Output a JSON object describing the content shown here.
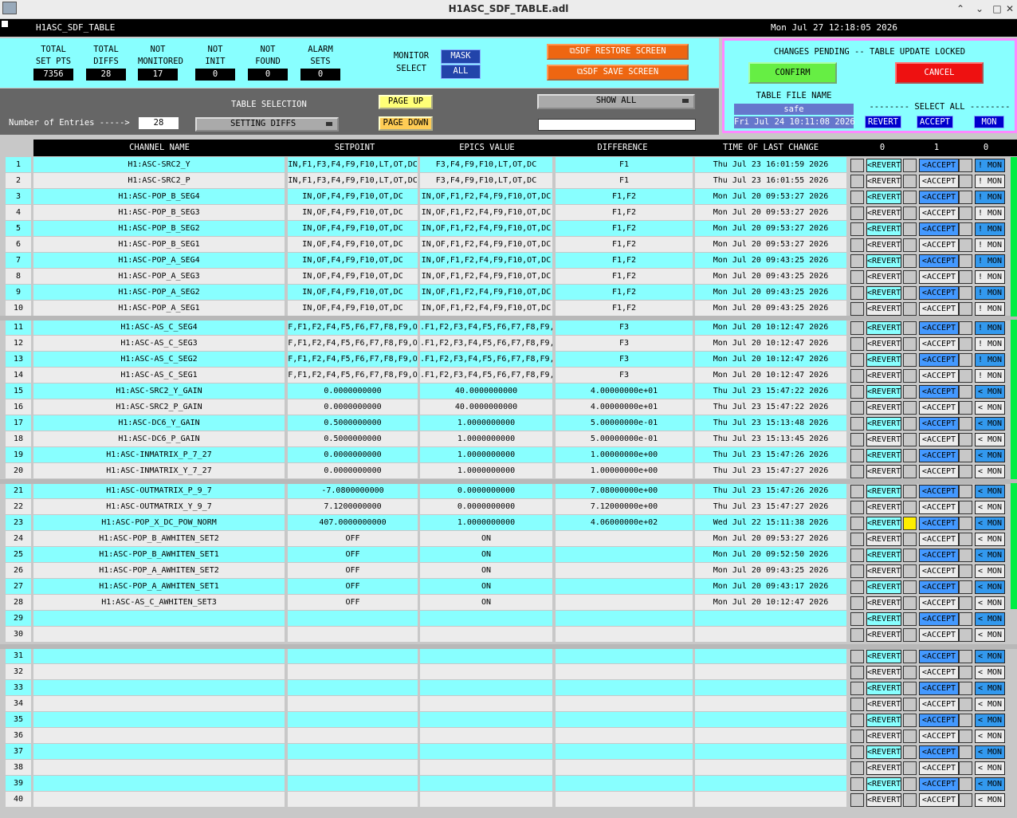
{
  "window": {
    "title": "H1ASC_SDF_TABLE.adl"
  },
  "header": {
    "screen_name": "H1ASC_SDF_TABLE",
    "datetime": "Mon Jul 27 12:18:05 2026"
  },
  "stats": [
    {
      "label1": "TOTAL",
      "label2": "SET PTS",
      "value": "7356"
    },
    {
      "label1": "TOTAL",
      "label2": "DIFFS",
      "value": "28"
    },
    {
      "label1": "NOT",
      "label2": "MONITORED",
      "value": "17"
    },
    {
      "label1": "NOT",
      "label2": "INIT",
      "value": "0"
    },
    {
      "label1": "NOT",
      "label2": "FOUND",
      "value": "0"
    },
    {
      "label1": "ALARM",
      "label2": "SETS",
      "value": "0"
    }
  ],
  "monitor": {
    "label1": "MONITOR",
    "label2": "SELECT",
    "mask": "MASK",
    "all": "ALL"
  },
  "sdf": {
    "restore": "⧉SDF RESTORE SCREEN",
    "save": "⧉SDF SAVE SCREEN"
  },
  "changes": {
    "title": "CHANGES PENDING -- TABLE UPDATE LOCKED",
    "confirm": "CONFIRM",
    "cancel": "CANCEL",
    "file_label": "TABLE FILE NAME",
    "file_name": "safe",
    "file_time": "Fri Jul 24 10:11:08 2026",
    "select_all": "-------- SELECT ALL --------",
    "revert": "REVERT",
    "accept": "ACCEPT",
    "mon": "MON"
  },
  "table_ctrl": {
    "entries_label": "Number of Entries ----->",
    "entries_value": "28",
    "selection_label": "TABLE SELECTION",
    "selection_value": "SETTING DIFFS",
    "page_up": "PAGE UP",
    "page_down": "PAGE DOWN",
    "show_all": "SHOW ALL",
    "filter_value": ""
  },
  "columns": {
    "channel": "CHANNEL NAME",
    "setpoint": "SETPOINT",
    "epics": "EPICS VALUE",
    "difference": "DIFFERENCE",
    "time": "TIME OF LAST CHANGE",
    "c0a": "0",
    "c1": "1",
    "c0b": "0"
  },
  "colors": {
    "cyan": "#88ffff",
    "light": "#ececec",
    "accept_blue": "#4499ff",
    "mon_blue": "#3399ee",
    "yellow": "#ffee00"
  },
  "rows": [
    {
      "n": "1",
      "name": "H1:ASC-SRC2_Y",
      "sp": "IN,F1,F3,F4,F9,F10,LT,OT,DC",
      "ev": "F3,F4,F9,F10,LT,OT,DC",
      "diff": "F1",
      "time": "Thu Jul 23 16:01:59 2026",
      "revert": "<REVERT",
      "accept": "<ACCEPT",
      "mon": "! MON"
    },
    {
      "n": "2",
      "name": "H1:ASC-SRC2_P",
      "sp": "IN,F1,F3,F4,F9,F10,LT,OT,DC",
      "ev": "F3,F4,F9,F10,LT,OT,DC",
      "diff": "F1",
      "time": "Thu Jul 23 16:01:55 2026",
      "revert": "<REVERT",
      "accept": "<ACCEPT",
      "mon": "! MON"
    },
    {
      "n": "3",
      "name": "H1:ASC-POP_B_SEG4",
      "sp": "IN,OF,F4,F9,F10,OT,DC",
      "ev": "IN,OF,F1,F2,F4,F9,F10,OT,DC",
      "diff": "F1,F2",
      "time": "Mon Jul 20 09:53:27 2026",
      "revert": "<REVERT",
      "accept": "<ACCEPT",
      "mon": "! MON"
    },
    {
      "n": "4",
      "name": "H1:ASC-POP_B_SEG3",
      "sp": "IN,OF,F4,F9,F10,OT,DC",
      "ev": "IN,OF,F1,F2,F4,F9,F10,OT,DC",
      "diff": "F1,F2",
      "time": "Mon Jul 20 09:53:27 2026",
      "revert": "<REVERT",
      "accept": "<ACCEPT",
      "mon": "! MON"
    },
    {
      "n": "5",
      "name": "H1:ASC-POP_B_SEG2",
      "sp": "IN,OF,F4,F9,F10,OT,DC",
      "ev": "IN,OF,F1,F2,F4,F9,F10,OT,DC",
      "diff": "F1,F2",
      "time": "Mon Jul 20 09:53:27 2026",
      "revert": "<REVERT",
      "accept": "<ACCEPT",
      "mon": "! MON"
    },
    {
      "n": "6",
      "name": "H1:ASC-POP_B_SEG1",
      "sp": "IN,OF,F4,F9,F10,OT,DC",
      "ev": "IN,OF,F1,F2,F4,F9,F10,OT,DC",
      "diff": "F1,F2",
      "time": "Mon Jul 20 09:53:27 2026",
      "revert": "<REVERT",
      "accept": "<ACCEPT",
      "mon": "! MON"
    },
    {
      "n": "7",
      "name": "H1:ASC-POP_A_SEG4",
      "sp": "IN,OF,F4,F9,F10,OT,DC",
      "ev": "IN,OF,F1,F2,F4,F9,F10,OT,DC",
      "diff": "F1,F2",
      "time": "Mon Jul 20 09:43:25 2026",
      "revert": "<REVERT",
      "accept": "<ACCEPT",
      "mon": "! MON"
    },
    {
      "n": "8",
      "name": "H1:ASC-POP_A_SEG3",
      "sp": "IN,OF,F4,F9,F10,OT,DC",
      "ev": "IN,OF,F1,F2,F4,F9,F10,OT,DC",
      "diff": "F1,F2",
      "time": "Mon Jul 20 09:43:25 2026",
      "revert": "<REVERT",
      "accept": "<ACCEPT",
      "mon": "! MON"
    },
    {
      "n": "9",
      "name": "H1:ASC-POP_A_SEG2",
      "sp": "IN,OF,F4,F9,F10,OT,DC",
      "ev": "IN,OF,F1,F2,F4,F9,F10,OT,DC",
      "diff": "F1,F2",
      "time": "Mon Jul 20 09:43:25 2026",
      "revert": "<REVERT",
      "accept": "<ACCEPT",
      "mon": "! MON"
    },
    {
      "n": "10",
      "name": "H1:ASC-POP_A_SEG1",
      "sp": "IN,OF,F4,F9,F10,OT,DC",
      "ev": "IN,OF,F1,F2,F4,F9,F10,OT,DC",
      "diff": "F1,F2",
      "time": "Mon Jul 20 09:43:25 2026",
      "revert": "<REVERT",
      "accept": "<ACCEPT",
      "mon": "! MON"
    },
    {
      "n": "11",
      "name": "H1:ASC-AS_C_SEG4",
      "sp": "F,F1,F2,F4,F5,F6,F7,F8,F9,O",
      "ev": ".F1,F2,F3,F4,F5,F6,F7,F8,F9,",
      "diff": "F3",
      "time": "Mon Jul 20 10:12:47 2026",
      "revert": "<REVERT",
      "accept": "<ACCEPT",
      "mon": "! MON"
    },
    {
      "n": "12",
      "name": "H1:ASC-AS_C_SEG3",
      "sp": "F,F1,F2,F4,F5,F6,F7,F8,F9,O",
      "ev": ".F1,F2,F3,F4,F5,F6,F7,F8,F9,",
      "diff": "F3",
      "time": "Mon Jul 20 10:12:47 2026",
      "revert": "<REVERT",
      "accept": "<ACCEPT",
      "mon": "! MON"
    },
    {
      "n": "13",
      "name": "H1:ASC-AS_C_SEG2",
      "sp": "F,F1,F2,F4,F5,F6,F7,F8,F9,O",
      "ev": ".F1,F2,F3,F4,F5,F6,F7,F8,F9,",
      "diff": "F3",
      "time": "Mon Jul 20 10:12:47 2026",
      "revert": "<REVERT",
      "accept": "<ACCEPT",
      "mon": "! MON"
    },
    {
      "n": "14",
      "name": "H1:ASC-AS_C_SEG1",
      "sp": "F,F1,F2,F4,F5,F6,F7,F8,F9,O",
      "ev": ".F1,F2,F3,F4,F5,F6,F7,F8,F9,",
      "diff": "F3",
      "time": "Mon Jul 20 10:12:47 2026",
      "revert": "<REVERT",
      "accept": "<ACCEPT",
      "mon": "! MON"
    },
    {
      "n": "15",
      "name": "H1:ASC-SRC2_Y_GAIN",
      "sp": "0.0000000000",
      "ev": "40.0000000000",
      "diff": "4.00000000e+01",
      "time": "Thu Jul 23 15:47:22 2026",
      "revert": "<REVERT",
      "accept": "<ACCEPT",
      "mon": "< MON"
    },
    {
      "n": "16",
      "name": "H1:ASC-SRC2_P_GAIN",
      "sp": "0.0000000000",
      "ev": "40.0000000000",
      "diff": "4.00000000e+01",
      "time": "Thu Jul 23 15:47:22 2026",
      "revert": "<REVERT",
      "accept": "<ACCEPT",
      "mon": "< MON"
    },
    {
      "n": "17",
      "name": "H1:ASC-DC6_Y_GAIN",
      "sp": "0.5000000000",
      "ev": "1.0000000000",
      "diff": "5.00000000e-01",
      "time": "Thu Jul 23 15:13:48 2026",
      "revert": "<REVERT",
      "accept": "<ACCEPT",
      "mon": "< MON"
    },
    {
      "n": "18",
      "name": "H1:ASC-DC6_P_GAIN",
      "sp": "0.5000000000",
      "ev": "1.0000000000",
      "diff": "5.00000000e-01",
      "time": "Thu Jul 23 15:13:45 2026",
      "revert": "<REVERT",
      "accept": "<ACCEPT",
      "mon": "< MON"
    },
    {
      "n": "19",
      "name": "H1:ASC-INMATRIX_P_7_27",
      "sp": "0.0000000000",
      "ev": "1.0000000000",
      "diff": "1.00000000e+00",
      "time": "Thu Jul 23 15:47:26 2026",
      "revert": "<REVERT",
      "accept": "<ACCEPT",
      "mon": "< MON"
    },
    {
      "n": "20",
      "name": "H1:ASC-INMATRIX_Y_7_27",
      "sp": "0.0000000000",
      "ev": "1.0000000000",
      "diff": "1.00000000e+00",
      "time": "Thu Jul 23 15:47:27 2026",
      "revert": "<REVERT",
      "accept": "<ACCEPT",
      "mon": "< MON"
    },
    {
      "n": "21",
      "name": "H1:ASC-OUTMATRIX_P_9_7",
      "sp": "-7.0800000000",
      "ev": "0.0000000000",
      "diff": "7.08000000e+00",
      "time": "Thu Jul 23 15:47:26 2026",
      "revert": "<REVERT",
      "accept": "<ACCEPT",
      "mon": "< MON"
    },
    {
      "n": "22",
      "name": "H1:ASC-OUTMATRIX_Y_9_7",
      "sp": "7.1200000000",
      "ev": "0.0000000000",
      "diff": "7.12000000e+00",
      "time": "Thu Jul 23 15:47:27 2026",
      "revert": "<REVERT",
      "accept": "<ACCEPT",
      "mon": "< MON"
    },
    {
      "n": "23",
      "name": "H1:ASC-POP_X_DC_POW_NORM",
      "sp": "407.0000000000",
      "ev": "1.0000000000",
      "diff": "4.06000000e+02",
      "time": "Wed Jul 22 15:11:38 2026",
      "revert": "<REVERT",
      "accept": "<ACCEPT",
      "mon": "< MON"
    },
    {
      "n": "24",
      "name": "H1:ASC-POP_B_AWHITEN_SET2",
      "sp": "OFF",
      "ev": "ON",
      "diff": "",
      "time": "Mon Jul 20 09:53:27 2026",
      "revert": "<REVERT",
      "accept": "<ACCEPT",
      "mon": "< MON"
    },
    {
      "n": "25",
      "name": "H1:ASC-POP_B_AWHITEN_SET1",
      "sp": "OFF",
      "ev": "ON",
      "diff": "",
      "time": "Mon Jul 20 09:52:50 2026",
      "revert": "<REVERT",
      "accept": "<ACCEPT",
      "mon": "< MON"
    },
    {
      "n": "26",
      "name": "H1:ASC-POP_A_AWHITEN_SET2",
      "sp": "OFF",
      "ev": "ON",
      "diff": "",
      "time": "Mon Jul 20 09:43:25 2026",
      "revert": "<REVERT",
      "accept": "<ACCEPT",
      "mon": "< MON"
    },
    {
      "n": "27",
      "name": "H1:ASC-POP_A_AWHITEN_SET1",
      "sp": "OFF",
      "ev": "ON",
      "diff": "",
      "time": "Mon Jul 20 09:43:17 2026",
      "revert": "<REVERT",
      "accept": "<ACCEPT",
      "mon": "< MON"
    },
    {
      "n": "28",
      "name": "H1:ASC-AS_C_AWHITEN_SET3",
      "sp": "OFF",
      "ev": "ON",
      "diff": "",
      "time": "Mon Jul 20 10:12:47 2026",
      "revert": "<REVERT",
      "accept": "<ACCEPT",
      "mon": "< MON"
    },
    {
      "n": "29",
      "name": "",
      "sp": "",
      "ev": "",
      "diff": "",
      "time": "",
      "revert": "<REVERT",
      "accept": "<ACCEPT",
      "mon": "< MON"
    },
    {
      "n": "30",
      "name": "",
      "sp": "",
      "ev": "",
      "diff": "",
      "time": "",
      "revert": "<REVERT",
      "accept": "<ACCEPT",
      "mon": "< MON"
    },
    {
      "n": "31",
      "name": "",
      "sp": "",
      "ev": "",
      "diff": "",
      "time": "",
      "revert": "<REVERT",
      "accept": "<ACCEPT",
      "mon": "< MON"
    },
    {
      "n": "32",
      "name": "",
      "sp": "",
      "ev": "",
      "diff": "",
      "time": "",
      "revert": "<REVERT",
      "accept": "<ACCEPT",
      "mon": "< MON"
    },
    {
      "n": "33",
      "name": "",
      "sp": "",
      "ev": "",
      "diff": "",
      "time": "",
      "revert": "<REVERT",
      "accept": "<ACCEPT",
      "mon": "< MON"
    },
    {
      "n": "34",
      "name": "",
      "sp": "",
      "ev": "",
      "diff": "",
      "time": "",
      "revert": "<REVERT",
      "accept": "<ACCEPT",
      "mon": "< MON"
    },
    {
      "n": "35",
      "name": "",
      "sp": "",
      "ev": "",
      "diff": "",
      "time": "",
      "revert": "<REVERT",
      "accept": "<ACCEPT",
      "mon": "< MON"
    },
    {
      "n": "36",
      "name": "",
      "sp": "",
      "ev": "",
      "diff": "",
      "time": "",
      "revert": "<REVERT",
      "accept": "<ACCEPT",
      "mon": "< MON"
    },
    {
      "n": "37",
      "name": "",
      "sp": "",
      "ev": "",
      "diff": "",
      "time": "",
      "revert": "<REVERT",
      "accept": "<ACCEPT",
      "mon": "< MON"
    },
    {
      "n": "38",
      "name": "",
      "sp": "",
      "ev": "",
      "diff": "",
      "time": "",
      "revert": "<REVERT",
      "accept": "<ACCEPT",
      "mon": "< MON"
    },
    {
      "n": "39",
      "name": "",
      "sp": "",
      "ev": "",
      "diff": "",
      "time": "",
      "revert": "<REVERT",
      "accept": "<ACCEPT",
      "mon": "< MON"
    },
    {
      "n": "40",
      "name": "",
      "sp": "",
      "ev": "",
      "diff": "",
      "time": "",
      "revert": "<REVERT",
      "accept": "<ACCEPT",
      "mon": "< MON"
    }
  ]
}
